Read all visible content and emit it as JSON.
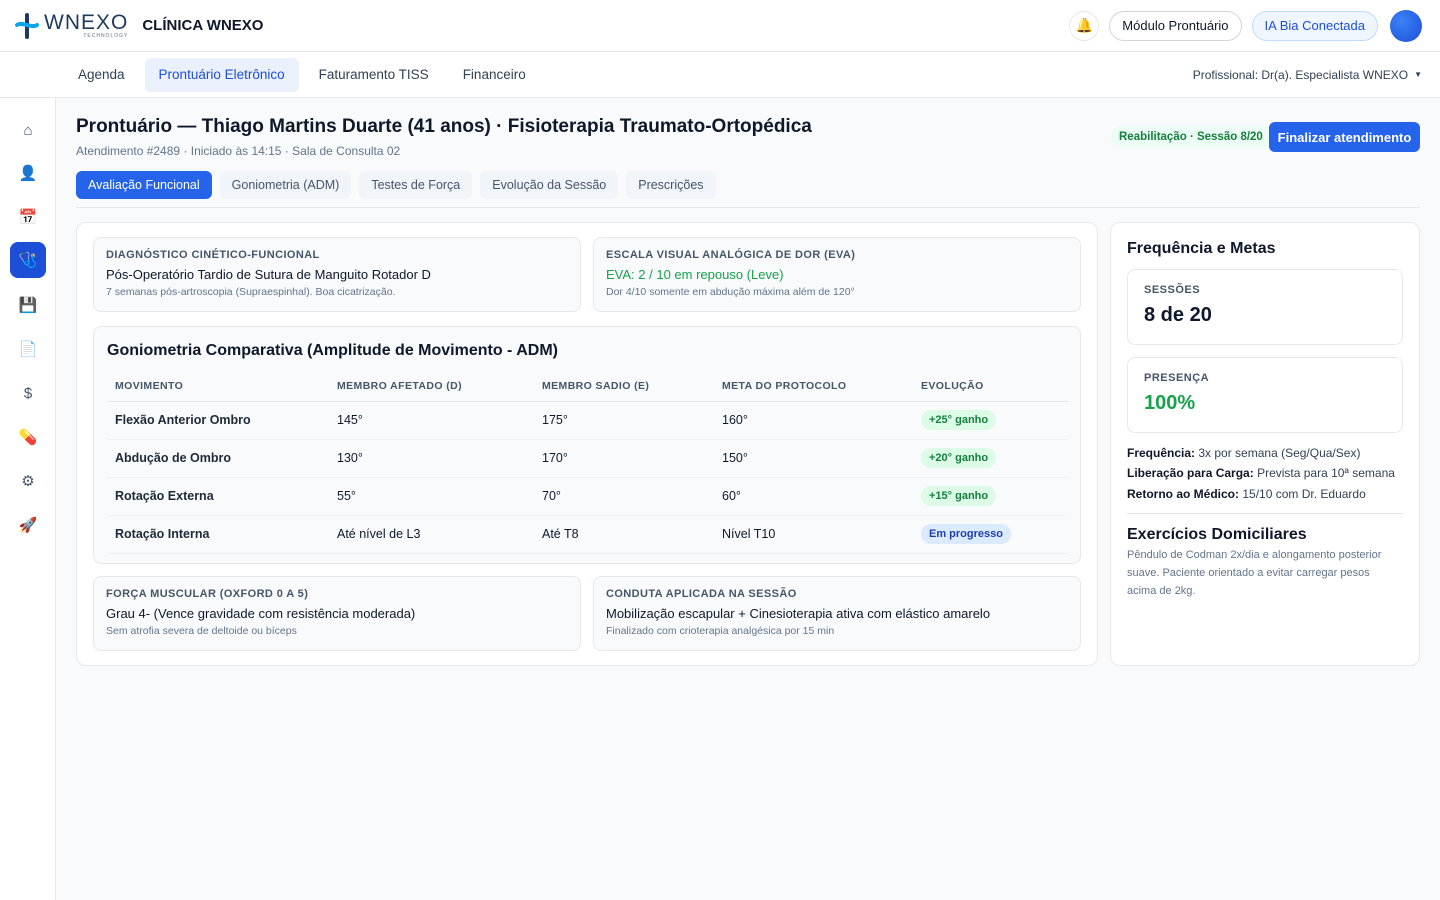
{
  "header": {
    "logo_word": "WNEXO",
    "logo_sub": "TECHNOLOGY",
    "clinic_name": "CLÍNICA WNEXO",
    "module_button": "Módulo Prontuário",
    "ai_button": "IA Bia Conectada"
  },
  "nav": {
    "items": [
      {
        "label": "Agenda"
      },
      {
        "label": "Prontuário Eletrônico"
      },
      {
        "label": "Faturamento TISS"
      },
      {
        "label": "Financeiro"
      }
    ],
    "professional": "Profissional: Dr(a). Especialista WNEXO"
  },
  "sidebar": {
    "items": [
      {
        "icon": "home-icon",
        "glyph": "⌂"
      },
      {
        "icon": "user-icon",
        "glyph": "👤"
      },
      {
        "icon": "calendar-icon",
        "glyph": "📅"
      },
      {
        "icon": "medical-record-icon",
        "glyph": "🩺"
      },
      {
        "icon": "save-icon",
        "glyph": "💾"
      },
      {
        "icon": "document-icon",
        "glyph": "📄"
      },
      {
        "icon": "dollar-icon",
        "glyph": "$"
      },
      {
        "icon": "pill-icon",
        "glyph": "💊"
      },
      {
        "icon": "gear-icon",
        "glyph": "⚙"
      },
      {
        "icon": "rocket-icon",
        "glyph": "🚀"
      }
    ]
  },
  "page": {
    "title": "Prontuário — Thiago Martins Duarte (41 anos) · Fisioterapia Traumato-Ortopédica",
    "subtitle": "Atendimento #2489 · Iniciado às 14:15 · Sala de Consulta 02",
    "session_badge": "Reabilitação · Sessão 8/20",
    "finish_button": "Finalizar atendimento"
  },
  "tabs": [
    {
      "label": "Avaliação Funcional"
    },
    {
      "label": "Goniometria (ADM)"
    },
    {
      "label": "Testes de Força"
    },
    {
      "label": "Evolução da Sessão"
    },
    {
      "label": "Prescrições"
    }
  ],
  "diagnosis": {
    "label": "Diagnóstico Cinético-Funcional",
    "value": "Pós-Operatório Tardio de Sutura de Manguito Rotador D",
    "note": "7 semanas pós-artroscopia (Supraespinhal). Boa cicatrização."
  },
  "pain_scale": {
    "label": "Escala Visual Analógica de Dor (EVA)",
    "value": "EVA: 2 / 10 em repouso (Leve)",
    "note": "Dor 4/10 somente em abdução máxima além de 120°"
  },
  "goniometry": {
    "title": "Goniometria Comparativa (Amplitude de Movimento - ADM)",
    "headers": [
      "Movimento",
      "Membro Afetado (D)",
      "Membro Sadio (E)",
      "Meta do Protocolo",
      "Evolução"
    ],
    "rows": [
      {
        "movement": "Flexão Anterior Ombro",
        "affected": "145°",
        "healthy": "175°",
        "goal": "160°",
        "evolution": "+25° ganho"
      },
      {
        "movement": "Abdução de Ombro",
        "affected": "130°",
        "healthy": "170°",
        "goal": "150°",
        "evolution": "+20° ganho"
      },
      {
        "movement": "Rotação Externa",
        "affected": "55°",
        "healthy": "70°",
        "goal": "60°",
        "evolution": "+15° ganho"
      },
      {
        "movement": "Rotação Interna",
        "affected": "Até nível de L3",
        "healthy": "Até T8",
        "goal": "Nível T10",
        "evolution": "Em progresso"
      }
    ]
  },
  "strength": {
    "label": "Força Muscular (Oxford 0 a 5)",
    "value": "Grau 4- (Vence gravidade com resistência moderada)",
    "note": "Sem atrofia severa de deltoide ou bíceps"
  },
  "conduct": {
    "label": "Conduta Aplicada na Sessão",
    "value": "Mobilização escapular + Cinesioterapia ativa com elástico amarelo",
    "note": "Finalizado com crioterapia analgésica por 15 min"
  },
  "goals": {
    "title": "Frequência e Metas",
    "sessions_label": "SESSÕES",
    "sessions_value": "8 de 20",
    "presence_label": "PRESENÇA",
    "presence_value": "100%",
    "frequency_key": "Frequência:",
    "frequency_value": "3x por semana (Seg/Qua/Sex)",
    "load_key": "Liberação para Carga:",
    "load_value": "Prevista para 10ª semana",
    "return_key": "Retorno ao Médico:",
    "return_value": "15/10 com Dr. Eduardo",
    "exercises_title": "Exercícios Domiciliares",
    "exercises_text": "Pêndulo de Codman 2x/dia e alongamento posterior suave. Paciente orientado a evitar carregar pesos acima de 2kg."
  },
  "colors": {
    "primary": "#2563eb",
    "success": "#16a34a",
    "success_bg": "#dcfce7",
    "info_bg": "#dbeafe"
  }
}
